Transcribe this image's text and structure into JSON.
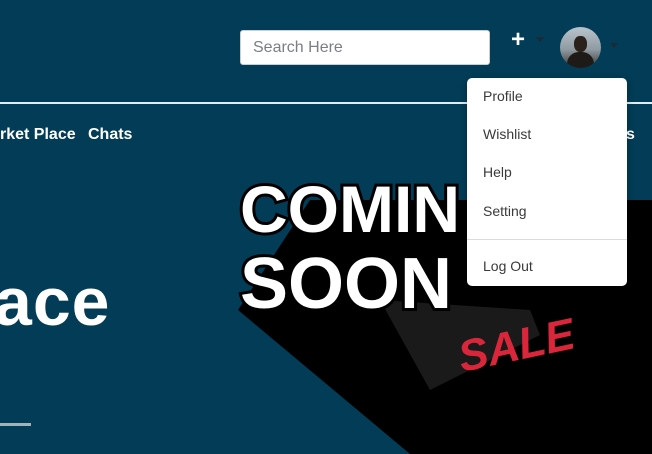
{
  "search": {
    "placeholder": "Search Here"
  },
  "header": {
    "add_icon": "plus-icon",
    "avatar_icon": "user-avatar"
  },
  "nav": {
    "items": [
      "rket Place",
      "Chats",
      "s"
    ]
  },
  "hero": {
    "text": "ace"
  },
  "promo": {
    "line1": "COMIN",
    "line2": "SOON",
    "badge": "SALE"
  },
  "dropdown": {
    "items": [
      "Profile",
      "Wishlist",
      "Help",
      "Setting"
    ],
    "logout": "Log Out"
  },
  "colors": {
    "background": "#023c56",
    "promo_shadow": "#000000",
    "sale_red": "#d9263a"
  }
}
